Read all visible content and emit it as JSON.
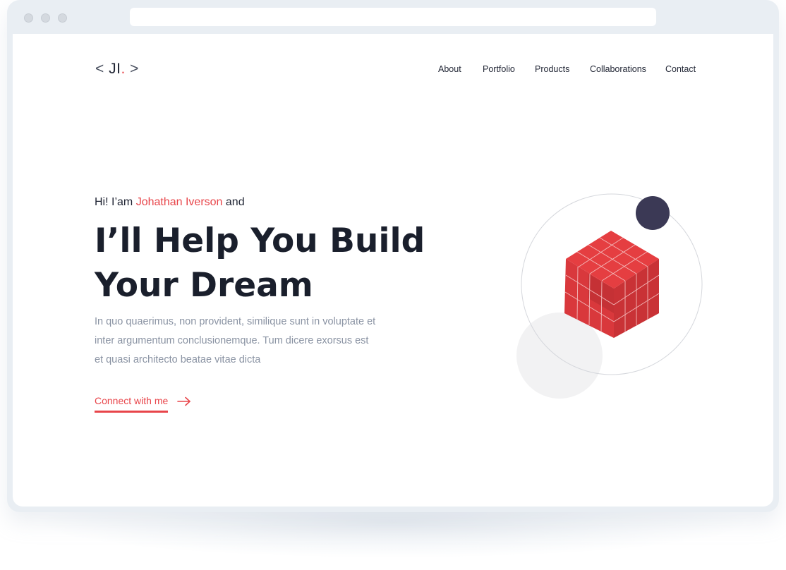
{
  "browser": {
    "url": ""
  },
  "header": {
    "logo": {
      "open": "<",
      "initials": "JI",
      "dot": ".",
      "close": ">"
    },
    "nav": [
      {
        "label": "About"
      },
      {
        "label": "Portfolio"
      },
      {
        "label": "Products"
      },
      {
        "label": "Collaborations"
      },
      {
        "label": "Contact"
      }
    ]
  },
  "hero": {
    "greeting_prefix": "Hi! I’am",
    "greeting_name": "Johathan Iverson",
    "greeting_suffix": "and",
    "headline_line1": "I’ll Help You Build",
    "headline_line2": "Your Dream",
    "lead": "In quo quaerimus, non provident, similique sunt in voluptate et inter argumentum conclusionemque. Tum dicere exorsus est et quasi architecto beatae vitae dicta",
    "cta_label": "Connect with me",
    "cta_icon": "arrow-right-icon"
  },
  "illustration": {
    "icon": "red-cube-illustration",
    "cube_colors": {
      "top": "#e53e41",
      "left": "#d9383c",
      "right": "#c93236",
      "grid_line": "#f3b8b9"
    },
    "orbit_ball_color": "#3b3955",
    "ghost_circle_color": "#f2f2f3"
  },
  "colors": {
    "accent": "#e8454a",
    "text_dark": "#1a1f2c",
    "text_muted": "#8a93a3",
    "window_chrome": "#e9eef3"
  }
}
